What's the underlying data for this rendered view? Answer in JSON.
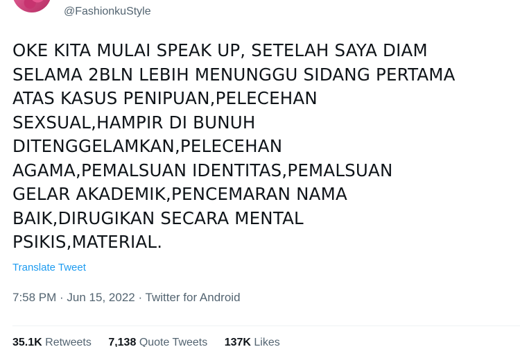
{
  "tweet": {
    "handle": "@FashionkuStyle",
    "text": "OKE KITA MULAI SPEAK UP, SETELAH SAYA DIAM\nSELAMA 2BLN LEBIH MENUNGGU SIDANG PERTAMA\nATAS KASUS PENIPUAN,PELECEHAN\nSEXSUAL,HAMPIR DI BUNUH\nDITENGGELAMKAN,PELECEHAN\nAGAMA,PEMALSUAN IDENTITAS,PEMALSUAN\nGELAR AKADEMIK,PENCEMARAN NAMA\nBAIK,DIRUGIKAN SECARA MENTAL\nPSIKIS,MATERIAL.",
    "translate_label": "Translate Tweet",
    "meta": "7:58 PM · Jun 15, 2022 · Twitter for Android"
  },
  "stats": {
    "retweets_count": "35.1K",
    "retweets_label": "Retweets",
    "quotes_count": "7,138",
    "quotes_label": "Quote Tweets",
    "likes_count": "137K",
    "likes_label": "Likes"
  },
  "colors": {
    "link": "#1d9bf0",
    "secondary_text": "#536471",
    "primary_text": "#0f1419"
  },
  "icons": {
    "avatar": "pink-flowers-avatar"
  }
}
